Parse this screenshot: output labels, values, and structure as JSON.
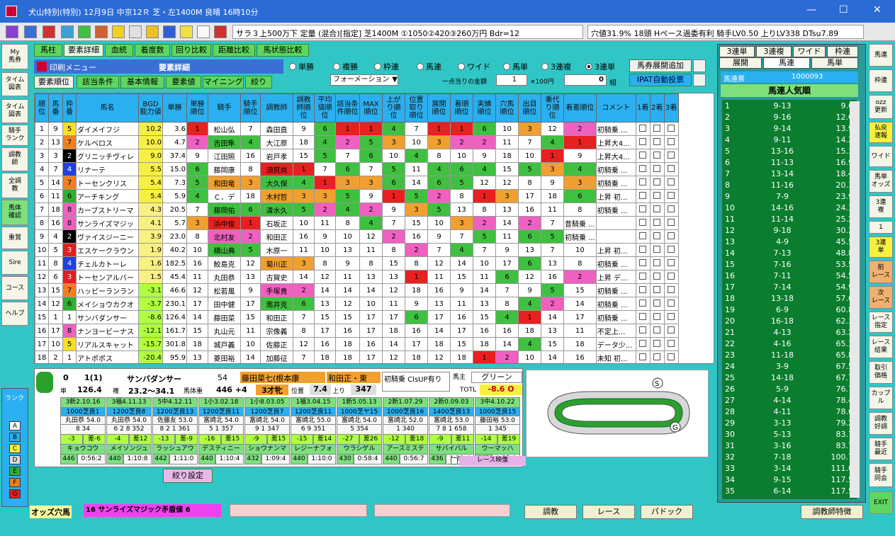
{
  "window": {
    "title": "犬山特別(特別)  12月9日  中京12Ｒ  芝・左1400M 良晴 16時10分",
    "min": "—",
    "max": "☐",
    "close": "✕"
  },
  "raceinfo": "サラ３上500万下  定量 (混合)[指定]  芝1400M ①1050②420③260万円 Bdr=12",
  "oddsinfo": "穴値31.9% 18頭  Hペース過委有利  騎手LV0.50 上りLV338 DTsu7.89",
  "left_nav": [
    "My\n馬券",
    "タイム\n図表",
    "タイム\n図表",
    "騎手\nランク",
    "調教\n師",
    "全調\n教",
    "馬体\n確認",
    "重賞",
    "Sire",
    "コース",
    "ヘルプ"
  ],
  "tabs": [
    "馬柱",
    "要素詳細",
    "血統",
    "着度数",
    "回り比較",
    "距離比較",
    "馬状態比較"
  ],
  "menu": {
    "print": "印刷メニュー",
    "title": "要素詳細"
  },
  "bet_types": [
    "単勝",
    "複勝",
    "枠連",
    "馬連",
    "ワイド",
    "馬単",
    "3連複",
    "3連単"
  ],
  "bet_selected": "3連単",
  "add_button": "馬券展開追加",
  "formation": "フォーメーション",
  "per_point_label": "一点当りの金額",
  "per_point_value": "1",
  "unit_label": "×100円",
  "count_value": "0",
  "count_unit": "組",
  "ipat_button": "IPAT自動投票",
  "sub_buttons": [
    "要素順位",
    "該当条件",
    "基本情報",
    "要素値",
    "マイニング",
    "絞り"
  ],
  "columns": [
    "順位",
    "馬番",
    "枠番",
    "馬名",
    "BGD能力値",
    "単勝",
    "単勝順位",
    "騎手",
    "騎手順位",
    "調教師",
    "調教師順位",
    "平均値順位",
    "該当条件順位",
    "MAX順位",
    "上がり順位",
    "位置取り順位",
    "展開順位",
    "着順順位",
    "実績順位",
    "穴馬順位",
    "出目順位",
    "乗代り順位",
    "着差順位",
    "コメント",
    "1着",
    "2着",
    "3着"
  ],
  "rows": [
    [
      "1",
      "9",
      "5",
      "ダイメイフジ",
      "10.2",
      "3.6",
      "1",
      "松山弘",
      "7",
      "森田直",
      "9",
      "6",
      "1",
      "1",
      "4",
      "7",
      "1",
      "1",
      "6",
      "10",
      "3",
      "12",
      "2",
      "初騎乗 ..."
    ],
    [
      "2",
      "13",
      "7",
      "ケルベロス",
      "10.0",
      "4.7",
      "2",
      "吉田隼",
      "4",
      "大江原",
      "18",
      "4",
      "2",
      "5",
      "3",
      "10",
      "3",
      "2",
      "2",
      "11",
      "7",
      "4",
      "1",
      "上昇大4..."
    ],
    [
      "3",
      "3",
      "2",
      "グリニッチヴィレ",
      "9.0",
      "37.4",
      "9",
      "江田照",
      "16",
      "岩戸孝",
      "15",
      "5",
      "7",
      "6",
      "10",
      "4",
      "8",
      "10",
      "9",
      "18",
      "10",
      "1",
      "9",
      "上昇大4..."
    ],
    [
      "4",
      "7",
      "4",
      "リナーテ",
      "5.5",
      "15.0",
      "6",
      "藤岡康",
      "8",
      "須貝尚",
      "1",
      "7",
      "6",
      "7",
      "5",
      "11",
      "4",
      "6",
      "4",
      "15",
      "5",
      "3",
      "4",
      "初騎乗 ..."
    ],
    [
      "5",
      "14",
      "7",
      "トーセンクリス",
      "5.4",
      "7.3",
      "5",
      "和田竜",
      "3",
      "大久保",
      "4",
      "1",
      "3",
      "3",
      "6",
      "14",
      "6",
      "5",
      "12",
      "12",
      "8",
      "9",
      "3",
      "初騎乗 ..."
    ],
    [
      "6",
      "11",
      "6",
      "アーチキング",
      "5.4",
      "5.9",
      "4",
      "Ｃ．デ",
      "18",
      "木村哲",
      "3",
      "3",
      "5",
      "9",
      "1",
      "5",
      "2",
      "8",
      "1",
      "3",
      "17",
      "18",
      "6",
      "上昇 初..."
    ],
    [
      "7",
      "18",
      "8",
      "カーブストリーマ",
      "4.3",
      "20.5",
      "7",
      "藤岡佑",
      "6",
      "清水久",
      "5",
      "2",
      "4",
      "2",
      "9",
      "3",
      "5",
      "13",
      "8",
      "13",
      "16",
      "11",
      "8",
      "初騎乗 ..."
    ],
    [
      "8",
      "16",
      "8",
      "サンライズマジッ",
      "4.1",
      "5.7",
      "3",
      "浜中俊",
      "1",
      "石坂正",
      "10",
      "11",
      "8",
      "4",
      "7",
      "15",
      "10",
      "3",
      "2",
      "14",
      "2",
      "7",
      "昔騎乗 ..."
    ],
    [
      "9",
      "4",
      "2",
      "ヴァイスジーニー",
      "3.9",
      "23.0",
      "8",
      "北村友",
      "2",
      "和田正",
      "16",
      "9",
      "10",
      "12",
      "2",
      "16",
      "9",
      "7",
      "5",
      "11",
      "6",
      "5",
      "初騎乗 ..."
    ],
    [
      "10",
      "5",
      "3",
      "エスケークラウン",
      "1.9",
      "40.2",
      "10",
      "横山典",
      "5",
      "木原一",
      "11",
      "10",
      "13",
      "11",
      "8",
      "2",
      "7",
      "4",
      "7",
      "9",
      "13",
      "7",
      "10",
      "上昇 初..."
    ],
    [
      "11",
      "8",
      "4",
      "チェルカトーレ",
      "1.6",
      "182.5",
      "16",
      "鮫島克",
      "12",
      "菊川正",
      "3",
      "8",
      "9",
      "8",
      "15",
      "8",
      "12",
      "14",
      "10",
      "17",
      "6",
      "13",
      "8",
      "初騎乗 ..."
    ],
    [
      "12",
      "6",
      "3",
      "トーセンアルバー",
      "1.5",
      "45.4",
      "11",
      "丸田恭",
      "13",
      "古賀史",
      "14",
      "12",
      "11",
      "13",
      "13",
      "1",
      "11",
      "15",
      "11",
      "6",
      "12",
      "16",
      "2",
      "上昇 デ..."
    ],
    [
      "13",
      "15",
      "7",
      "ハッピーランラン",
      "-3.1",
      "46.6",
      "12",
      "松若風",
      "9",
      "手塚貴",
      "2",
      "14",
      "14",
      "14",
      "12",
      "18",
      "16",
      "9",
      "14",
      "7",
      "9",
      "5",
      "15",
      "初騎乗 ..."
    ],
    [
      "14",
      "12",
      "6",
      "メイショウカクオ",
      "-3.7",
      "230.1",
      "17",
      "田中健",
      "17",
      "南井克",
      "6",
      "13",
      "12",
      "10",
      "11",
      "9",
      "13",
      "11",
      "13",
      "8",
      "4",
      "2",
      "14",
      "初騎乗 ..."
    ],
    [
      "15",
      "1",
      "1",
      "サンバダンサー",
      "-8.6",
      "126.4",
      "14",
      "藤田菜",
      "15",
      "和田正",
      "7",
      "15",
      "15",
      "17",
      "17",
      "6",
      "17",
      "16",
      "15",
      "4",
      "1",
      "14",
      "17",
      "初騎乗 ..."
    ],
    [
      "16",
      "17",
      "8",
      "ナンヨービーナス",
      "-12.1",
      "161.7",
      "15",
      "丸山元",
      "11",
      "宗像義",
      "8",
      "17",
      "16",
      "17",
      "18",
      "16",
      "14",
      "17",
      "16",
      "16",
      "18",
      "13",
      "11",
      "不定上..."
    ],
    [
      "17",
      "10",
      "5",
      "リアルスキャット",
      "-15.7",
      "301.8",
      "18",
      "城戸義",
      "10",
      "佐藤正",
      "12",
      "16",
      "18",
      "16",
      "14",
      "17",
      "18",
      "15",
      "18",
      "14",
      "4",
      "15",
      "18",
      "データ少..."
    ],
    [
      "18",
      "2",
      "1",
      "アトポポス",
      "-20.4",
      "95.9",
      "13",
      "菱田裕",
      "14",
      "加藤征",
      "7",
      "18",
      "18",
      "17",
      "12",
      "18",
      "12",
      "18",
      "1",
      "2",
      "10",
      "14",
      "16",
      "未知 初..."
    ]
  ],
  "detail": {
    "no": "0",
    "pos": "1(1)",
    "name": "サンバダンサー",
    "weight": "54",
    "jockey": "藤田菜七(根本康",
    "trainer": "和田正・東",
    "comment": "初騎乗 ClsUP有り",
    "owner_label": "馬主",
    "owner": "グリーン",
    "win_label": "単",
    "win": "126.4",
    "place_label": "複",
    "place": "23.2〜34.1",
    "bw_label": "馬体重",
    "bw": "446 +4",
    "age": "3才牝",
    "pos_label": "位置",
    "posv": "7.4",
    "last_label": "上り",
    "lastv": "347",
    "totl_label": "TOTL",
    "totl": "-8.6 O",
    "history": [
      {
        "date": "3新2.10.16",
        "course": "1000芝良1",
        "jk": "丸田恭 54.0",
        "st": "8  34",
        "diff": "-3",
        "rank": "差-6",
        "horse": "キョウコウ",
        "time": "0:56:2",
        "w": "446"
      },
      {
        "date": "3福4.11.13",
        "course": "1200芝良8",
        "jk": "丸田恭 54.0",
        "st": "6 2 8 352",
        "diff": "-4",
        "rank": "差12",
        "horse": "メイソンジュ",
        "time": "1:10:8",
        "w": "440"
      },
      {
        "date": "5中4.12.11",
        "course": "1200芝良13",
        "jk": "佐藤友 53.0",
        "st": "8 2 1 361",
        "diff": "-13",
        "rank": "差-9",
        "horse": "ラッシュアウ",
        "time": "1:11:0",
        "w": "442"
      },
      {
        "date": "1小3.02.18",
        "course": "1200芝良11",
        "jk": "富崎北 54.0",
        "st": "5 1 357",
        "diff": "-16",
        "rank": "差15",
        "horse": "デスティニー",
        "time": "1:10:4",
        "w": "440"
      },
      {
        "date": "1小8.03.05",
        "course": "1200芝良7",
        "jk": "富崎北 54.0",
        "st": "9 1 347",
        "diff": "-9",
        "rank": "差15",
        "horse": "ショウナンマ",
        "time": "1:09:4",
        "w": "432"
      },
      {
        "date": "1福3.04.15",
        "course": "1200芝良11",
        "jk": "富崎北 55.0",
        "st": "6 9 351",
        "diff": "-15",
        "rank": "差14",
        "horse": "レジーナフォ",
        "time": "1:10:0",
        "w": "440"
      },
      {
        "date": "1新5.05.13",
        "course": "1000芝ヤ15",
        "jk": "富崎北 54.0",
        "st": "5 354",
        "diff": "-27",
        "rank": "差26",
        "horse": "ウラシゲル",
        "time": "0:58:4",
        "w": "430"
      },
      {
        "date": "2新1.07.29",
        "course": "1000芝良16",
        "jk": "富崎北 52.0",
        "st": "1 340",
        "diff": "-12",
        "rank": "差18",
        "horse": "アースミステ",
        "time": "0:56:7",
        "w": "440"
      },
      {
        "date": "2新0.09.03",
        "course": "1400芝良13",
        "jk": "富崎北 53.0",
        "st": "7 8 1 658",
        "diff": "-9",
        "rank": "差11",
        "horse": "サバイバル",
        "time": "1:22:4",
        "w": "436"
      },
      {
        "date": "3中4.10.22",
        "course": "1000芝良15",
        "jk": "藤田裕 53.0",
        "st": "1 345",
        "diff": "-14",
        "rank": "差19",
        "horse": "ウーマッハ",
        "time": "0:57:8",
        "w": "442"
      }
    ]
  },
  "course_labels": {
    "start": "S",
    "goal": "G",
    "video": "レース映像"
  },
  "narrow_button": "絞り設定",
  "right_tabs": [
    "3連単",
    "3連複",
    "ワイド",
    "枠連",
    "展開",
    "馬連",
    "馬単"
  ],
  "odds_header": {
    "label": "馬連票",
    "value": "1000093",
    "title": "馬連人気順"
  },
  "odds": [
    [
      "1",
      "9-13",
      "9.6"
    ],
    [
      "2",
      "9-16",
      "12.0"
    ],
    [
      "3",
      "9-14",
      "13.9"
    ],
    [
      "4",
      "9-11",
      "14.2"
    ],
    [
      "5",
      "13-16",
      "15.3"
    ],
    [
      "6",
      "11-13",
      "16.9"
    ],
    [
      "7",
      "13-14",
      "18.4"
    ],
    [
      "8",
      "11-16",
      "20.3"
    ],
    [
      "9",
      "7-9",
      "23.9"
    ],
    [
      "10",
      "14-16",
      "24.3"
    ],
    [
      "11",
      "11-14",
      "25.2"
    ],
    [
      "12",
      "9-18",
      "30.2"
    ],
    [
      "13",
      "4-9",
      "45.5"
    ],
    [
      "14",
      "7-13",
      "48.8"
    ],
    [
      "15",
      "7-16",
      "53.5"
    ],
    [
      "16",
      "7-11",
      "54.5"
    ],
    [
      "17",
      "7-14",
      "54.9"
    ],
    [
      "18",
      "13-18",
      "57.6"
    ],
    [
      "19",
      "6-9",
      "60.8"
    ],
    [
      "20",
      "16-18",
      "62.3"
    ],
    [
      "21",
      "4-13",
      "63.2"
    ],
    [
      "22",
      "4-16",
      "65.3"
    ],
    [
      "23",
      "11-18",
      "65.8"
    ],
    [
      "24",
      "3-9",
      "67.5"
    ],
    [
      "25",
      "14-18",
      "67.7"
    ],
    [
      "26",
      "5-9",
      "76.7"
    ],
    [
      "27",
      "4-14",
      "78.4"
    ],
    [
      "28",
      "4-11",
      "78.6"
    ],
    [
      "29",
      "3-13",
      "79.2"
    ],
    [
      "30",
      "5-13",
      "83.7"
    ],
    [
      "31",
      "3-16",
      "83.7"
    ],
    [
      "32",
      "7-18",
      "100.7"
    ],
    [
      "33",
      "3-14",
      "111.0"
    ],
    [
      "34",
      "9-15",
      "117.5"
    ],
    [
      "35",
      "6-14",
      "117.5"
    ]
  ],
  "right_nav": [
    "馬連",
    "枠連",
    "ozz\n更新",
    "払戻\n速報",
    "ワイド",
    "馬単\nオッズ",
    "3連\n複",
    "1",
    "3連\n単",
    "前\nレース",
    "次\nレース",
    "レース\n指定",
    "レース\n結果",
    "取引\n価格",
    "カップ\nル",
    "調教\n好調",
    "騎手\n最近",
    "騎手\n同会",
    "EXIT"
  ],
  "rank_label": "ランク",
  "ranks": [
    "A",
    "B",
    "C",
    "D",
    "E",
    "F",
    "G"
  ],
  "bottom": {
    "anaba_label": "オッズ穴馬",
    "anaba_value": "16 サンライズマジック矛盾値  6",
    "btn1": "調教",
    "btn2": "レース",
    "btn3": "パドック",
    "btn4": "調教師特徴"
  }
}
